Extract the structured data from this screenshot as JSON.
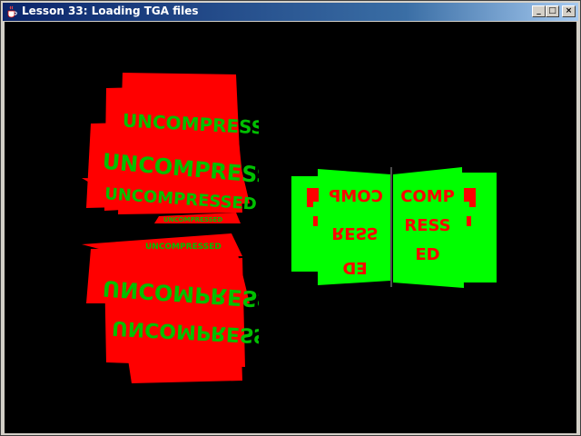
{
  "window": {
    "title": "Lesson 33: Loading TGA files",
    "controls": {
      "minimize": "_",
      "maximize": "□",
      "close": "×"
    }
  },
  "scene": {
    "left_texture_text": "UNCOMPRESSED",
    "right_texture_text": "COMPRESSED",
    "right_panel_rows": [
      "COMP",
      "RESS",
      "ED"
    ],
    "colors": {
      "background": "#000000",
      "red": "#ff0000",
      "green": "#00ff00"
    }
  }
}
